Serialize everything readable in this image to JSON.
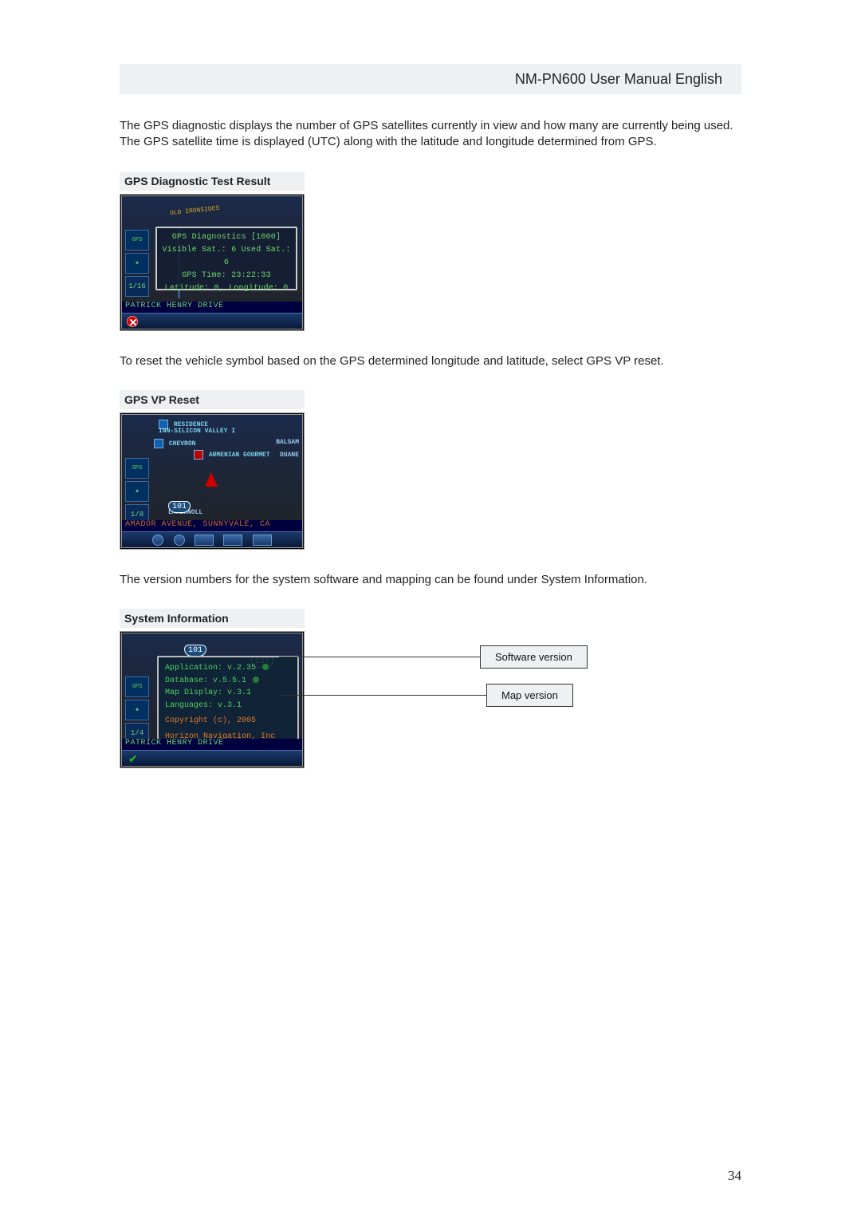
{
  "header": {
    "title": "NM-PN600 User Manual  English"
  },
  "para1": "The GPS diagnostic displays the number of GPS satellites currently in view and how many are currently being used.  The GPS satellite time is displayed (UTC) along with the latitude and longitude determined from GPS.",
  "para2": "To reset the vehicle symbol based on the GPS determined longitude and latitude, select GPS VP reset.",
  "para3": "The version numbers for the system software and mapping can be found under System Information.",
  "page_number": "34",
  "sec1": {
    "caption": "GPS Diagnostic Test Result",
    "road_top": "OLD IRONSIDES",
    "diag_title": "GPS Diagnostics [1000]",
    "diag_sat": "Visible Sat.: 6 Used Sat.: 6",
    "diag_time": "GPS Time: 23:22:33",
    "diag_latlon": "Latitude: 0, Longitude: 0",
    "street": "PATRICK HENRY DRIVE",
    "side_gps": "GPS",
    "side_scale": "1/16"
  },
  "sec2": {
    "caption": "GPS VP Reset",
    "poi_res": "RESIDENCE",
    "poi_inn": "INN-SILICON VALLEY I",
    "poi_chev": "CHEVRON",
    "poi_arm": "ARMENIAN GOURMET",
    "poi_balsam": "BALSAM",
    "poi_duane": "DUANE",
    "poi_lake": "LAKEKNOLL",
    "hwy101": "101",
    "side_gps": "GPS",
    "side_scale": "1/8",
    "street": "AMADOR AVENUE, SUNNYVALE, CA"
  },
  "sec3": {
    "caption": "System Information",
    "hwy101": "101",
    "hwy237": "237",
    "line_app": "Application: v.2.35",
    "line_db": "Database: v.5.5.1",
    "line_map": "Map Display: v.3.1",
    "line_lang": "Languages: v.3.1",
    "copy1": "Copyright (c), 2005",
    "copy2": "Horizon Navigation, Inc",
    "cont": "Continue",
    "side_gps": "GPS",
    "side_scale": "1/4",
    "street": "PATRICK HENRY DRIVE",
    "callout_sw": "Software version",
    "callout_map": "Map version"
  }
}
